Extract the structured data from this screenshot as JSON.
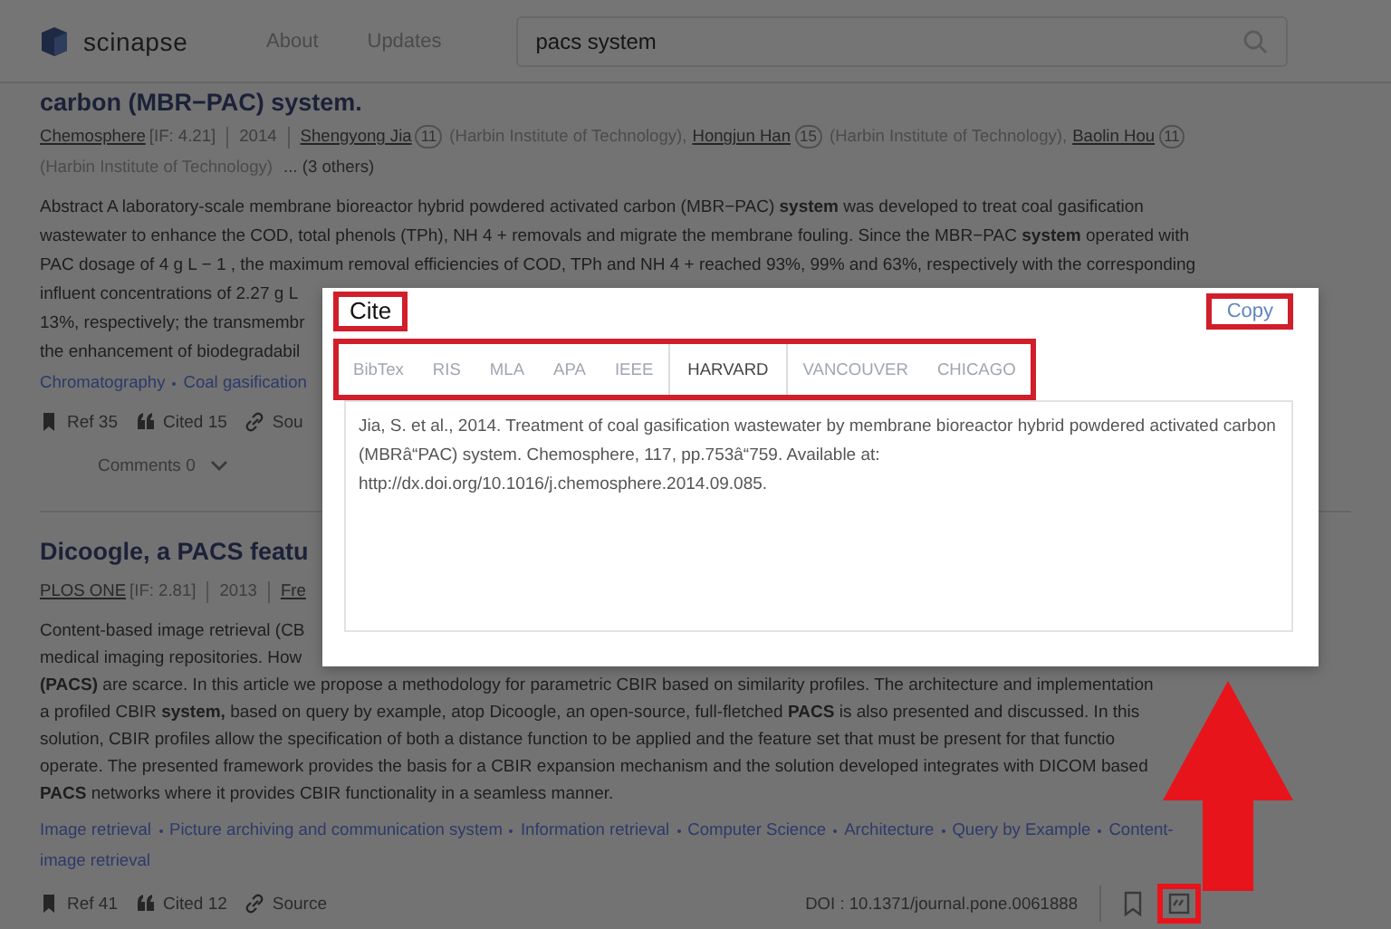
{
  "header": {
    "logo": "scinapse",
    "nav": [
      "About",
      "Updates"
    ],
    "search": {
      "value": "pacs system"
    }
  },
  "papers": [
    {
      "title": "carbon (MBR−PAC) system.",
      "venue": "Chemosphere",
      "impact": "[IF: 4.21]",
      "year": "2014",
      "authors": [
        {
          "name": "Shengyong Jia",
          "count": "11",
          "affiliation": "(Harbin Institute of Technology),"
        },
        {
          "name": "Hongjun Han",
          "count": "15",
          "affiliation": "(Harbin Institute of Technology),"
        },
        {
          "name": "Baolin Hou",
          "count": "11",
          "affiliation": "(Harbin Institute of Technology)"
        }
      ],
      "others": "... (3 others)",
      "abstract_lines": [
        "Abstract A laboratory-scale membrane bioreactor hybrid powdered activated carbon (MBR−PAC) **system** was developed to treat coal gasification",
        "wastewater to enhance the COD, total phenols (TPh), NH 4 + removals and migrate the membrane fouling. Since the MBR−PAC **system** operated with",
        "PAC dosage of 4 g L − 1 , the maximum removal efficiencies of COD, TPh and NH 4 + reached 93%, 99% and 63%, respectively with the corresponding",
        "influent concentrations of 2.27 g L",
        "13%, respectively; the transmembr",
        "the enhancement of biodegradabil"
      ],
      "keyword_lines": [
        [
          "Chromatography",
          "Coal gasification"
        ]
      ],
      "actions": [
        {
          "kind": "ref",
          "label": "Ref 35"
        },
        {
          "kind": "cited",
          "label": "Cited 15"
        },
        {
          "kind": "source",
          "label": "Sou"
        }
      ],
      "comments": "Comments 0"
    },
    {
      "title": "Dicoogle, a PACS featu",
      "venue": "PLOS ONE",
      "impact": "[IF: 2.81]",
      "year": "2013",
      "authors": [
        {
          "name": "Fre"
        }
      ],
      "abstract_lines": [
        "Content-based image retrieval (CB",
        "medical imaging repositories. How",
        "**(PACS)** are scarce. In this article we propose a methodology for parametric CBIR based on similarity profiles. The architecture and implementation",
        "a profiled CBIR **system,** based on query by example, atop Dicoogle, an open-source, full-fletched **PACS** is also presented and discussed. In this",
        "solution, CBIR profiles allow the specification of both a distance function to be applied and the feature set that must be present for that functio",
        "operate. The presented framework provides the basis for a CBIR expansion mechanism and the solution developed integrates with DICOM based",
        "**PACS** networks where it provides CBIR functionality in a seamless manner."
      ],
      "keyword_lines": [
        [
          "Image retrieval",
          "Picture archiving and communication system",
          "Information retrieval",
          "Computer Science",
          "Architecture",
          "Query by Example",
          "Content-"
        ],
        [
          "image retrieval"
        ]
      ],
      "actions": [
        {
          "kind": "ref",
          "label": "Ref 41"
        },
        {
          "kind": "cited",
          "label": "Cited 12"
        },
        {
          "kind": "source",
          "label": "Source"
        }
      ],
      "doi": "DOI : 10.1371/journal.pone.0061888",
      "cite_icon_highlighted": true
    }
  ],
  "cite_dialog": {
    "title": {
      "text": "Cite",
      "highlighted": true
    },
    "copy": {
      "text": "Copy",
      "highlighted": true
    },
    "tabs_highlighted": true,
    "tabs": [
      {
        "label": "BibTex",
        "selected": false
      },
      {
        "label": "RIS",
        "selected": false
      },
      {
        "label": "MLA",
        "selected": false
      },
      {
        "label": "APA",
        "selected": false
      },
      {
        "label": "IEEE",
        "selected": false
      },
      {
        "label": "HARVARD",
        "selected": true
      },
      {
        "label": "VANCOUVER",
        "selected": false
      },
      {
        "label": "CHICAGO",
        "selected": false
      }
    ],
    "citation": "Jia, S. et al., 2014. Treatment of coal gasification wastewater by membrane bioreactor hybrid powdered activated carbon (MBRâ“PAC) system. Chemosphere, 117, pp.753â“759. Available at: http://dx.doi.org/10.1016/j.chemosphere.2014.09.085."
  }
}
